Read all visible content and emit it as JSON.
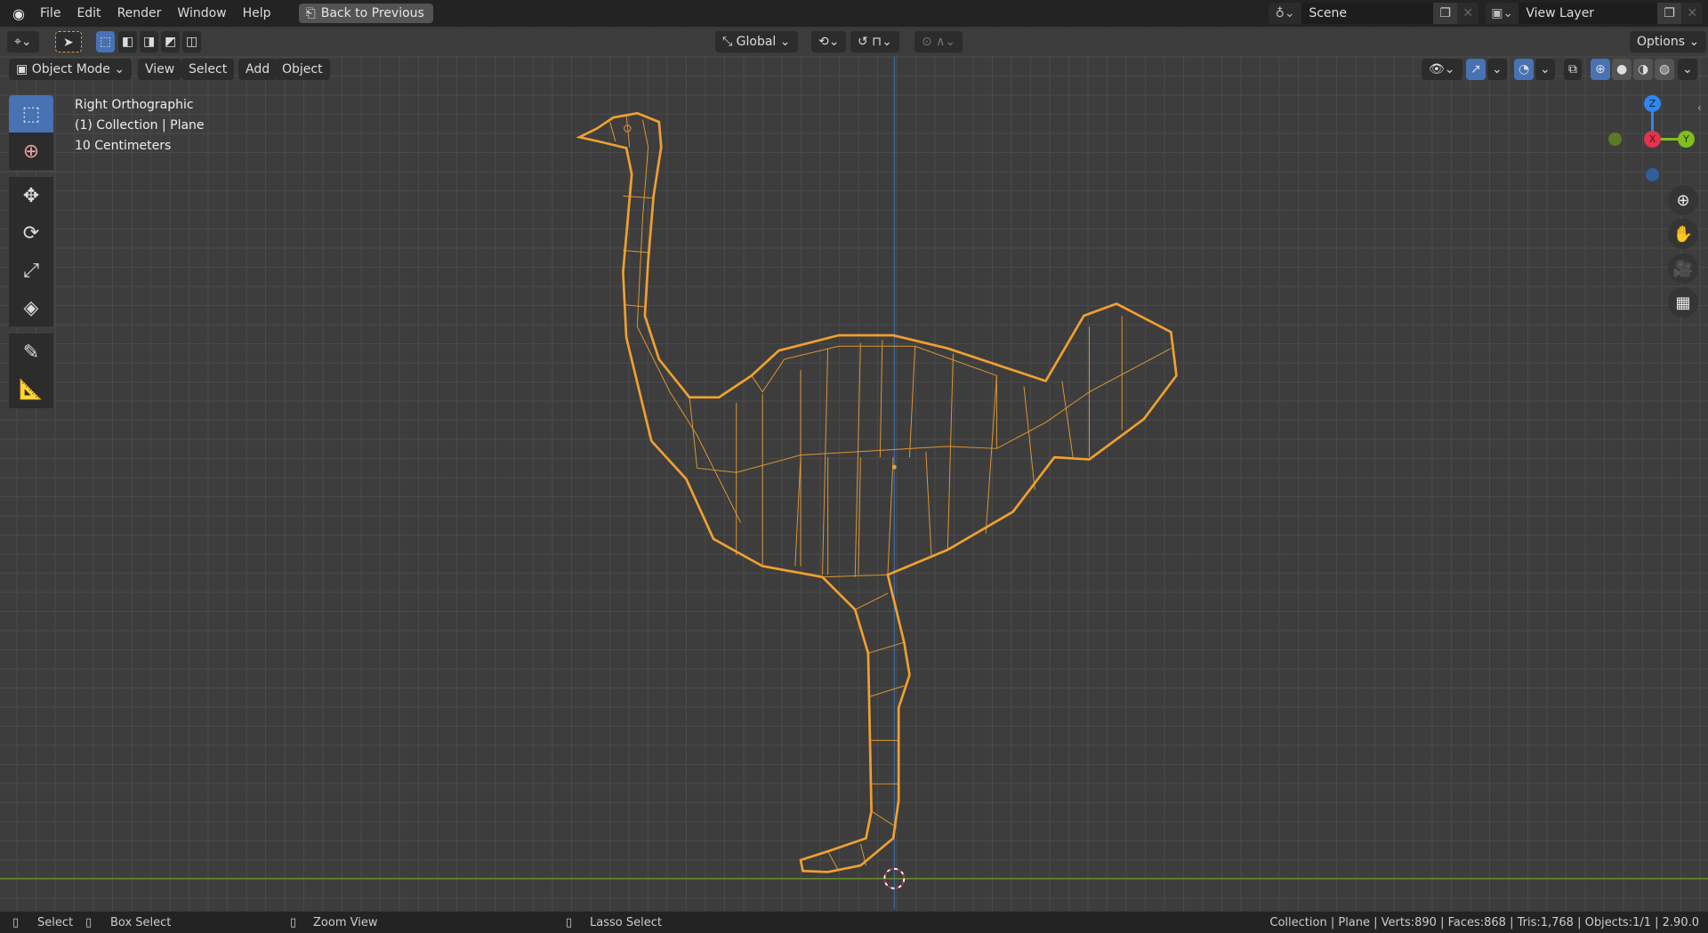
{
  "topbar": {
    "menus": [
      "File",
      "Edit",
      "Render",
      "Window",
      "Help"
    ],
    "back_button": "Back to Previous",
    "scene": "Scene",
    "view_layer": "View Layer"
  },
  "tool_header": {
    "orientation": "Global",
    "options": "Options"
  },
  "view_header": {
    "mode": "Object Mode",
    "menus": [
      "View",
      "Select",
      "Add",
      "Object"
    ]
  },
  "overlay_info": {
    "view": "Right Orthographic",
    "collection": "(1) Collection | Plane",
    "scale": "10 Centimeters"
  },
  "gizmo": {
    "z": "Z",
    "x": "X",
    "y": "Y",
    "colors": {
      "x": "#e2344f",
      "y": "#7fbf1e",
      "z": "#2f86f0"
    }
  },
  "statusbar": {
    "select": "Select",
    "box_select": "Box Select",
    "zoom_view": "Zoom View",
    "lasso_select": "Lasso Select",
    "stats": "Collection | Plane | Verts:890 | Faces:868 | Tris:1,768 | Objects:1/1 | 2.90.0"
  },
  "colors": {
    "selection": "#f0a030",
    "accent": "#4772b3"
  }
}
